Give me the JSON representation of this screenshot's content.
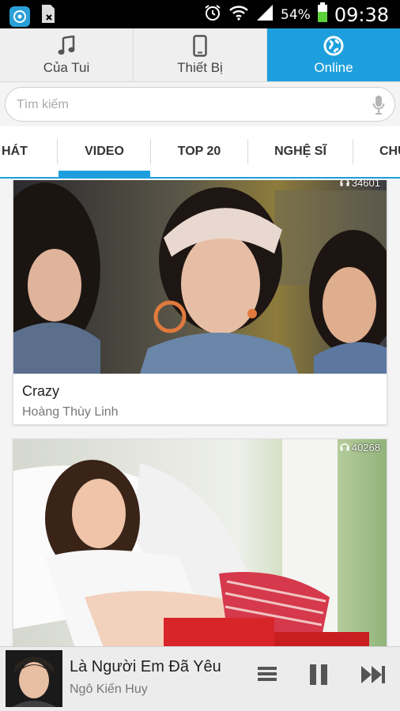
{
  "status_bar": {
    "battery_percent": "54%",
    "time": "09:38",
    "icons": [
      "app-icon",
      "document-x-icon",
      "alarm-icon",
      "wifi-icon",
      "signal-icon",
      "battery-icon"
    ]
  },
  "top_tabs": [
    {
      "label": "Của Tui",
      "icon": "music-note-icon",
      "active": false
    },
    {
      "label": "Thiết Bị",
      "icon": "phone-device-icon",
      "active": false
    },
    {
      "label": "Online",
      "icon": "globe-icon",
      "active": true
    }
  ],
  "search": {
    "placeholder": "Tìm kiếm",
    "value": ""
  },
  "sub_tabs": [
    {
      "label": "BÀI HÁT",
      "visible_label": "I HÁT",
      "active": false
    },
    {
      "label": "VIDEO",
      "active": true
    },
    {
      "label": "TOP 20",
      "active": false
    },
    {
      "label": "NGHỆ SĨ",
      "active": false
    },
    {
      "label": "CHU",
      "active": false
    }
  ],
  "videos": [
    {
      "title": "Crazy",
      "artist": "Hoàng Thùy Linh",
      "listen_count": "34601"
    },
    {
      "title": "",
      "artist": "",
      "listen_count": "40268"
    }
  ],
  "now_playing": {
    "title": "Là Người Em Đã Yêu",
    "artist": "Ngô Kiến Huy"
  },
  "colors": {
    "accent": "#1e9fdd",
    "status_bar": "#000000",
    "player_bg": "#ececec"
  }
}
